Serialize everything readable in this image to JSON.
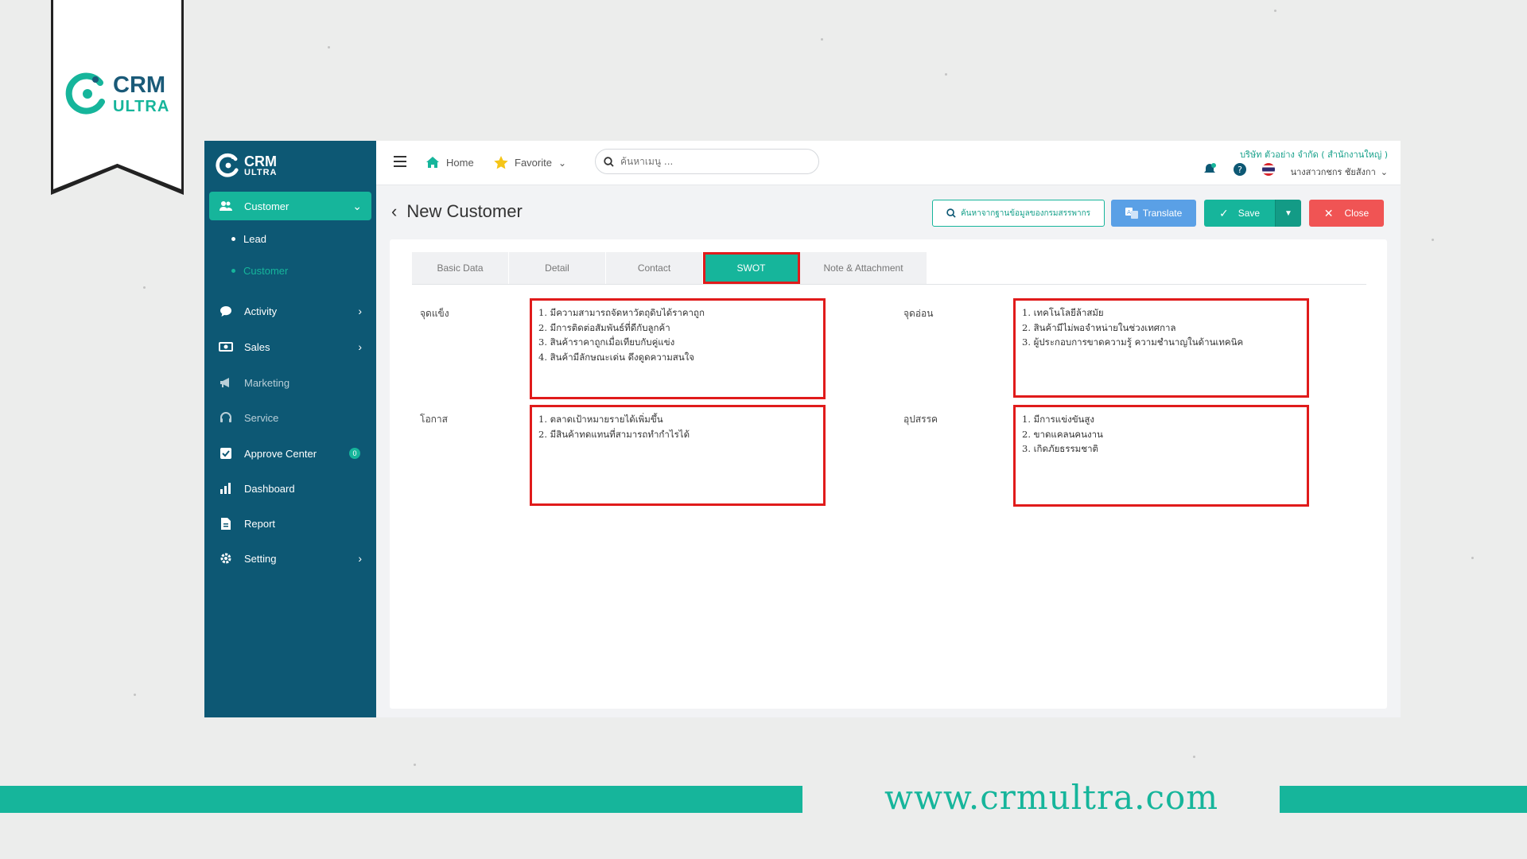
{
  "brand": {
    "name": "CRM",
    "sub": "ULTRA",
    "colors": {
      "primary": "#0d5874",
      "accent": "#16b59b",
      "danger": "#f05454",
      "info": "#5aa0e6"
    }
  },
  "sidebar": {
    "items": [
      {
        "label": "Customer",
        "icon": "users-icon",
        "active": true
      },
      {
        "label": "Activity",
        "icon": "chat-icon"
      },
      {
        "label": "Sales",
        "icon": "cash-icon"
      },
      {
        "label": "Marketing",
        "icon": "megaphone-icon"
      },
      {
        "label": "Service",
        "icon": "headset-icon"
      },
      {
        "label": "Approve Center",
        "icon": "check-square-icon",
        "badge": "0"
      },
      {
        "label": "Dashboard",
        "icon": "bar-chart-icon"
      },
      {
        "label": "Report",
        "icon": "file-icon"
      },
      {
        "label": "Setting",
        "icon": "gear-icon"
      }
    ],
    "sub": [
      {
        "label": "Lead"
      },
      {
        "label": "Customer",
        "active": true
      }
    ]
  },
  "topbar": {
    "home": "Home",
    "favorite": "Favorite",
    "search_placeholder": "ค้นหาเมนู ...",
    "company": "บริษัท ตัวอย่าง จำกัด ( สำนักงานใหญ่ )",
    "user": "นางสาวกชกร ชัยสังกา"
  },
  "page": {
    "title": "New Customer",
    "gov_search": "ค้นหาจากฐานข้อมูลของกรมสรรพากร",
    "translate": "Translate",
    "save": "Save",
    "close": "Close"
  },
  "tabs": [
    "Basic Data",
    "Detail",
    "Contact",
    "SWOT",
    "Note & Attachment"
  ],
  "active_tab": "SWOT",
  "swot": {
    "strengths": {
      "label": "จุดแข็ง",
      "lines": [
        "1. มีความสามารถจัดหาวัตถุดิบได้ราคาถูก",
        "2. มีการติดต่อสัมพันธ์ที่ดีกับลูกค้า",
        "3. สินค้าราคาถูกเมื่อเทียบกับคู่แข่ง",
        "4. สินค้ามีลักษณะเด่น ดึงดูดความสนใจ"
      ]
    },
    "weaknesses": {
      "label": "จุดอ่อน",
      "lines": [
        "1. เทคโนโลยีล้าสมัย",
        "2. สินค้ามีไม่พอจำหน่ายในช่วงเทศกาล",
        "3. ผู้ประกอบการขาดความรู้ ความชำนาญในด้านเทคนิค"
      ]
    },
    "opportunities": {
      "label": "โอกาส",
      "lines": [
        "1. ตลาดเป้าหมายรายได้เพิ่มขึ้น",
        "2. มีสินค้าทดแทนที่สามารถทำกำไรได้"
      ]
    },
    "threats": {
      "label": "อุปสรรค",
      "lines": [
        "1. มีการแข่งขันสูง",
        "2. ขาดแคลนคนงาน",
        "3. เกิดภัยธรรมชาติ"
      ]
    }
  },
  "footer": {
    "url": "www.crmultra.com"
  }
}
